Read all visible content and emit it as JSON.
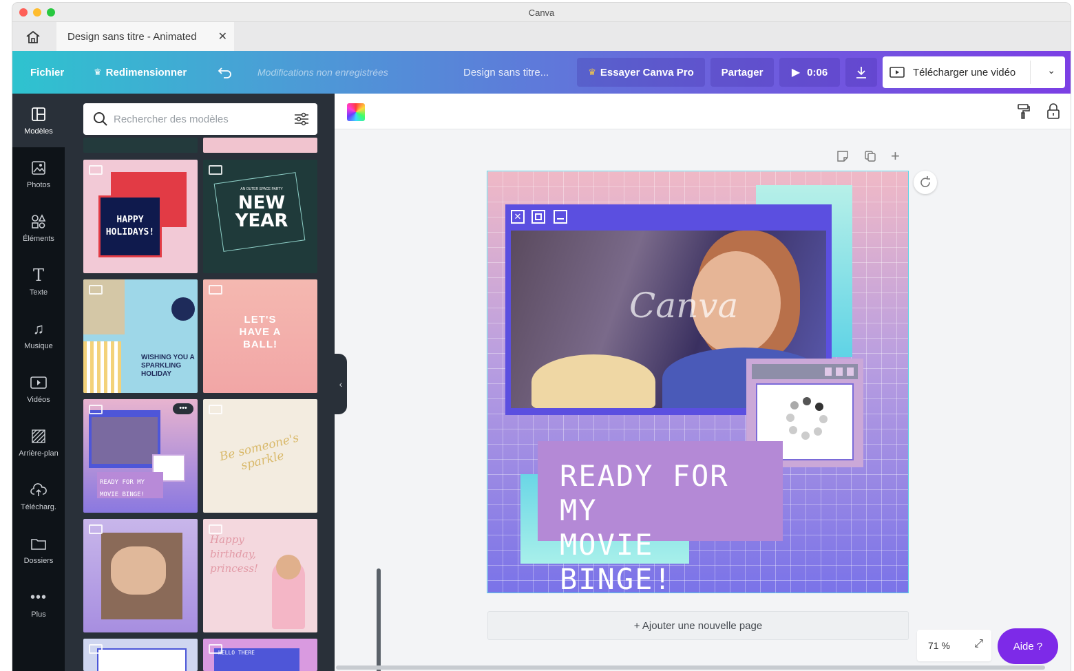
{
  "window": {
    "title": "Canva"
  },
  "tab": {
    "title": "Design sans titre - Animated"
  },
  "toolbar": {
    "file": "Fichier",
    "resize": "Redimensionner",
    "status": "Modifications non enregistrées",
    "design_title": "Design sans titre...",
    "try_pro": "Essayer Canva Pro",
    "share": "Partager",
    "duration": "0:06",
    "download_video": "Télécharger une vidéo"
  },
  "rail": [
    {
      "label": "Modèles",
      "icon": "templates-icon",
      "active": true
    },
    {
      "label": "Photos",
      "icon": "photos-icon"
    },
    {
      "label": "Éléments",
      "icon": "elements-icon"
    },
    {
      "label": "Texte",
      "icon": "text-icon"
    },
    {
      "label": "Musique",
      "icon": "music-icon"
    },
    {
      "label": "Vidéos",
      "icon": "videos-icon"
    },
    {
      "label": "Arrière-plan",
      "icon": "background-icon"
    },
    {
      "label": "Télécharg.",
      "icon": "upload-icon"
    },
    {
      "label": "Dossiers",
      "icon": "folder-icon"
    },
    {
      "label": "Plus",
      "icon": "more-icon"
    }
  ],
  "search": {
    "placeholder": "Rechercher des modèles"
  },
  "templates": [
    {
      "text": "HAPPY HOLIDAYS!"
    },
    {
      "text": "NEW YEAR",
      "subtext": "AN OUTER SPACE PARTY"
    },
    {
      "text": "WISHING YOU A SPARKLING HOLIDAY"
    },
    {
      "text": "LET'S HAVE A BALL!"
    },
    {
      "text": "READY FOR MY MOVIE BINGE!"
    },
    {
      "text": "Be someone's sparkle"
    },
    {
      "text": ""
    },
    {
      "text": "Happy birthday, princess!"
    },
    {
      "text": ""
    },
    {
      "text": "HELLO THERE"
    }
  ],
  "canvas": {
    "headline_line1": "READY FOR MY",
    "headline_line2": "MOVIE BINGE!",
    "watermark": "Canva",
    "add_page": "+ Ajouter une nouvelle page"
  },
  "footer": {
    "zoom": "71 %",
    "help": "Aide ?"
  },
  "colors": {
    "brand_purple": "#7d2ae8",
    "toolbar_start": "#2ec3cf",
    "toolbar_end": "#7b3fe4"
  }
}
